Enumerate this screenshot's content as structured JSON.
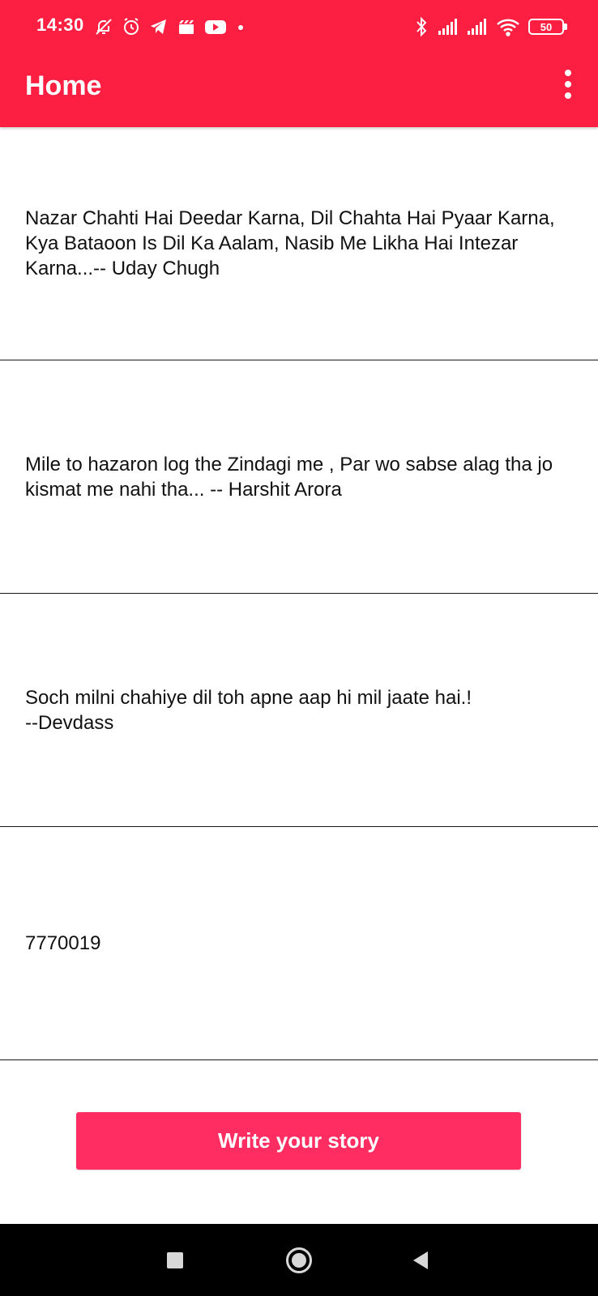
{
  "status_bar": {
    "time": "14:30",
    "left_icons": [
      "bell-off-icon",
      "alarm-icon",
      "telegram-icon",
      "clapper-icon",
      "youtube-icon",
      "dot-icon"
    ],
    "right_icons": [
      "bluetooth-icon",
      "signal-icon",
      "signal-icon",
      "wifi-icon"
    ],
    "battery": "50"
  },
  "toolbar": {
    "title": "Home",
    "menu_icon": "more-vert-icon",
    "background": "#fd1f41"
  },
  "stories": [
    {
      "text": "Nazar Chahti Hai Deedar Karna, Dil Chahta Hai Pyaar Karna, Kya Bataoon Is Dil Ka Aalam, Nasib Me Likha Hai Intezar Karna...-- Uday Chugh"
    },
    {
      "text": "Mile to hazaron log the Zindagi me , Par wo sabse alag tha jo kismat me nahi tha... -- Harshit Arora"
    },
    {
      "text": "Soch milni chahiye dil toh apne aap hi mil jaate hai.!\n--Devdass"
    },
    {
      "text": "7770019"
    }
  ],
  "write_button": {
    "label": "Write your story",
    "color": "#ff2d61"
  },
  "nav_bar": {
    "icons": [
      "recents-icon",
      "home-icon",
      "back-icon"
    ]
  }
}
